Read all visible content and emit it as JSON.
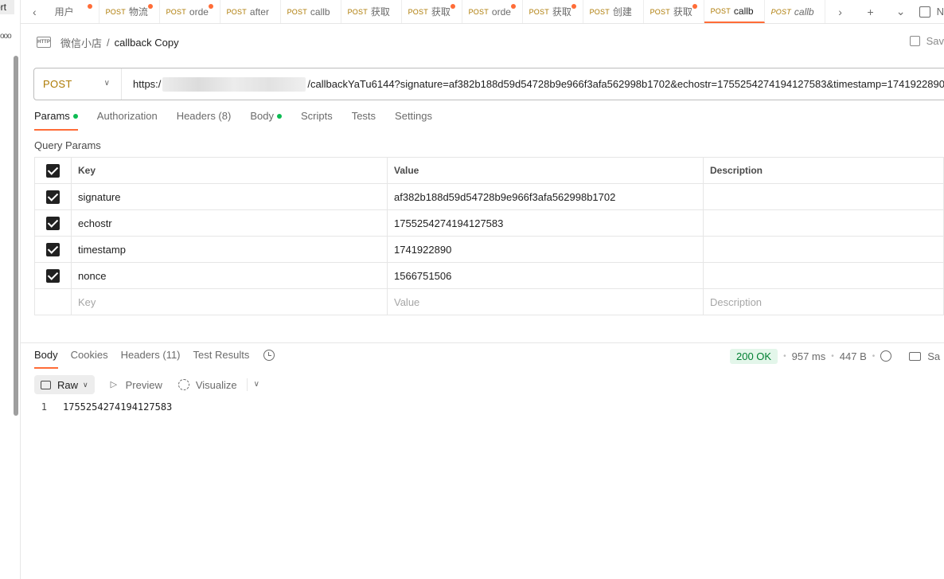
{
  "sidebar": {
    "label_fragment": "ort",
    "more_icon": "more-dots-icon"
  },
  "tabs": [
    {
      "method": "",
      "name": "用户",
      "unsaved": true
    },
    {
      "method": "POST",
      "name": "物流",
      "unsaved": true
    },
    {
      "method": "POST",
      "name": "orde",
      "unsaved": true
    },
    {
      "method": "POST",
      "name": "after",
      "unsaved": false
    },
    {
      "method": "POST",
      "name": "callb",
      "unsaved": false
    },
    {
      "method": "POST",
      "name": "获取",
      "unsaved": false
    },
    {
      "method": "POST",
      "name": "获取",
      "unsaved": true
    },
    {
      "method": "POST",
      "name": "orde",
      "unsaved": true
    },
    {
      "method": "POST",
      "name": "获取",
      "unsaved": true
    },
    {
      "method": "POST",
      "name": "创建",
      "unsaved": false
    },
    {
      "method": "POST",
      "name": "获取",
      "unsaved": true
    },
    {
      "method": "POST",
      "name": "callb",
      "unsaved": false,
      "active": true
    },
    {
      "method": "POST",
      "name": "callb",
      "unsaved": false,
      "italic": true
    }
  ],
  "tab_tools": {
    "env_label": "N"
  },
  "breadcrumb": {
    "icon_text": "HTTP",
    "parent": "微信小店",
    "separator": "/",
    "current": "callback Copy"
  },
  "save_label": "Sav",
  "request": {
    "method": "POST",
    "url_prefix": "https:/",
    "url_suffix": "/callbackYaTu6144?signature=af382b188d59d54728b9e966f3afa562998b1702&echostr=1755254274194127583&timestamp=1741922890"
  },
  "request_tabs": [
    {
      "label": "Params",
      "dot": true,
      "active": true
    },
    {
      "label": "Authorization",
      "dot": false
    },
    {
      "label": "Headers (8)",
      "dot": false
    },
    {
      "label": "Body",
      "dot": true
    },
    {
      "label": "Scripts",
      "dot": false
    },
    {
      "label": "Tests",
      "dot": false
    },
    {
      "label": "Settings",
      "dot": false
    }
  ],
  "query_params": {
    "title": "Query Params",
    "headers": {
      "key": "Key",
      "value": "Value",
      "description": "Description"
    },
    "rows": [
      {
        "key": "signature",
        "value": "af382b188d59d54728b9e966f3afa562998b1702",
        "description": ""
      },
      {
        "key": "echostr",
        "value": "1755254274194127583",
        "description": ""
      },
      {
        "key": "timestamp",
        "value": "1741922890",
        "description": ""
      },
      {
        "key": "nonce",
        "value": "1566751506",
        "description": ""
      }
    ],
    "placeholders": {
      "key": "Key",
      "value": "Value",
      "description": "Description"
    }
  },
  "response_tabs": [
    {
      "label": "Body",
      "active": true
    },
    {
      "label": "Cookies"
    },
    {
      "label": "Headers (11)"
    },
    {
      "label": "Test Results"
    }
  ],
  "response_meta": {
    "status": "200 OK",
    "time": "957 ms",
    "size": "447 B",
    "save_label": "Sa"
  },
  "response_toolbar": {
    "raw": "Raw",
    "preview": "Preview",
    "visualize": "Visualize"
  },
  "response_body": {
    "line_number": "1",
    "line": "1755254274194127583"
  },
  "colors": {
    "accent": "#ff6c37",
    "post_method": "#ad7a03",
    "status_ok_bg": "#e3f6ea",
    "status_ok_text": "#007f31",
    "dot_green": "#0cbb52"
  }
}
